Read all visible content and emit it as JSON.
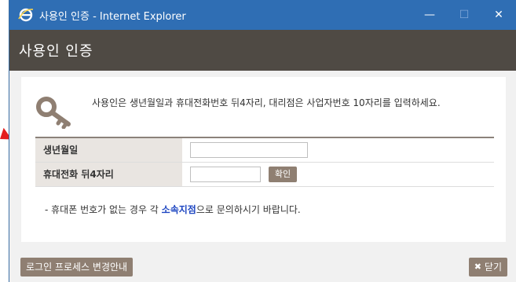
{
  "window": {
    "title": "사용인 인증 - Internet Explorer",
    "controls": {
      "minimize": "—",
      "maximize": "☐",
      "close": "✕"
    }
  },
  "header": {
    "title": "사용인 인증"
  },
  "intro": {
    "text": "사용인은 생년월일과 휴대전화번호 뒤4자리, 대리점은 사업자번호 10자리를 입력하세요."
  },
  "form": {
    "birth_label": "생년월일",
    "birth_value": "",
    "phone_label": "휴대전화 뒤4자리",
    "phone_value": "",
    "confirm_label": "확인"
  },
  "notice": {
    "prefix": "- 휴대폰 번호가 없는 경우 각 ",
    "highlight": "소속지점",
    "suffix": "으로 문의하시기 바랍니다."
  },
  "footer": {
    "process_label": "로그인 프로세스 변경안내",
    "close_icon": "✖",
    "close_label": "닫기"
  },
  "colors": {
    "titlebar": "#2f6eb4",
    "header_band": "#4f4a44",
    "button": "#8f7f72",
    "highlight": "#1f47c2",
    "arrow": "#e41d1d"
  }
}
